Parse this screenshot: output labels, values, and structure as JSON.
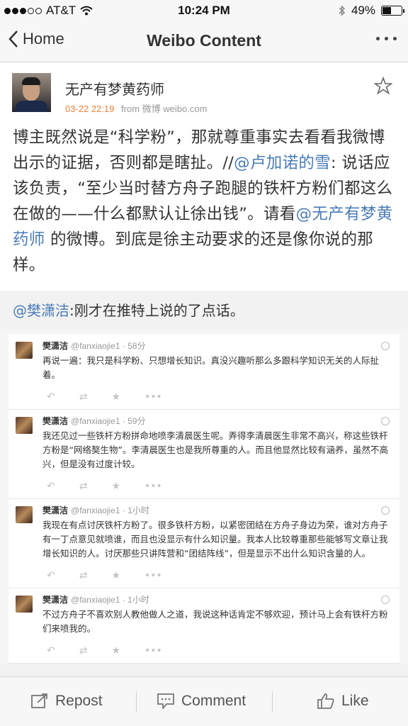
{
  "status_bar": {
    "carrier": "AT&T",
    "time": "10:24 PM",
    "battery": "49%",
    "battery_level": 0.49,
    "signal_bars": 3,
    "signal_total": 5
  },
  "nav": {
    "back_label": "Home",
    "title": "Weibo Content"
  },
  "post": {
    "author": "无产有梦黄药师",
    "time": "03-22 22:19",
    "source": "from 微博 weibo.com",
    "body": {
      "part1": "博主既然说是“科学粉”，那就尊重事实去看看我微博出示的证据，否则都是瞎扯。//",
      "mention1": "@卢加诺的雪",
      "part2": ": 说话应该负责，“至少当时替方舟子跑腿的铁杆方粉们都这么在做的——什么都默认让徐出钱”。请看",
      "mention2": "@无产有梦黄药师",
      "part3": " 的微博。到底是徐主动要求的还是像你说的那样。"
    }
  },
  "repost": {
    "mention": "@樊潇洁",
    "text": ":刚才在推特上说的了点话。",
    "tweets": [
      {
        "name": "樊潇洁",
        "handle": "@fanxiaojie1 · 58分",
        "text": "再说一遍：我只是科学粉、只想增长知识。真没兴趣听那么多跟科学知识无关的人际扯着。"
      },
      {
        "name": "樊潇洁",
        "handle": "@fanxiaojie1 · 59分",
        "text": "我还见过一些铁杆方粉拼命地喷李清晨医生呢。弄得李清晨医生非常不高兴，称这些铁杆方粉是“网络獒生物”。李清晨医生也是我所尊重的人。而且他显然比较有涵养，虽然不高兴，但是没有过度计较。"
      },
      {
        "name": "樊潇洁",
        "handle": "@fanxiaojie1 · 1小时",
        "text": "我现在有点讨厌铁杆方粉了。很多铁杆方粉，以紧密团结在方舟子身边为荣，谁对方舟子有一丁点意见就喷谁，而且也没显示有什么知识量。我本人比较尊重那些能够写文章让我增长知识的人。讨厌那些只讲阵营和“团结阵线”，但是显示不出什么知识含量的人。"
      },
      {
        "name": "樊潇洁",
        "handle": "@fanxiaojie1 · 1小时",
        "text": "不过方舟子不喜欢别人教他做人之道，我说这种话肯定不够欢迎，预计马上会有铁杆方粉们来喷我的。"
      }
    ]
  },
  "bottom_bar": {
    "repost_label": "Repost",
    "comment_label": "Comment",
    "like_label": "Like"
  },
  "colors": {
    "mention": "#4a7bb7",
    "time_accent": "#e8833a"
  },
  "icons": [
    "wifi-icon",
    "bluetooth-icon",
    "battery-icon",
    "back-chevron-icon",
    "more-icon",
    "star-icon",
    "repost-icon",
    "comment-icon",
    "like-icon",
    "reply-icon",
    "retweet-icon",
    "favorite-icon",
    "more-dots-icon",
    "globe-icon"
  ]
}
